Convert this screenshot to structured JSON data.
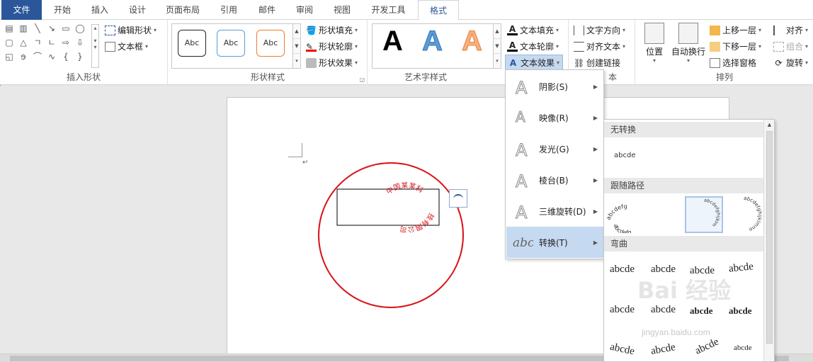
{
  "tabs": [
    {
      "label": "文件"
    },
    {
      "label": "开始"
    },
    {
      "label": "插入"
    },
    {
      "label": "设计"
    },
    {
      "label": "页面布局"
    },
    {
      "label": "引用"
    },
    {
      "label": "邮件"
    },
    {
      "label": "审阅"
    },
    {
      "label": "视图"
    },
    {
      "label": "开发工具"
    },
    {
      "label": "格式"
    }
  ],
  "ribbon": {
    "insert_shape": {
      "label": "插入形状",
      "edit_shape": "编辑形状",
      "text_box": "文本框"
    },
    "shape_styles": {
      "label": "形状样式",
      "style_sample": "Abc",
      "fill": "形状填充",
      "outline": "形状轮廓",
      "effects": "形状效果"
    },
    "wordart": {
      "label": "艺术字样式",
      "letter": "A",
      "text_fill": "文本填充",
      "text_outline": "文本轮廓",
      "text_effects": "文本效果"
    },
    "text": {
      "label_partial": "本",
      "direction": "文字方向",
      "align": "对齐文本",
      "link": "创建链接"
    },
    "arrange": {
      "label": "排列",
      "position": "位置",
      "wrap": "自动换行",
      "bring_forward": "上移一层",
      "send_backward": "下移一层",
      "selection_pane": "选择窗格",
      "align": "对齐",
      "group": "组合",
      "rotate": "旋转"
    }
  },
  "document": {
    "stamp_top": "中国某某科",
    "stamp_bottom": "技有限公司",
    "paragraph_mark": "↵"
  },
  "menu": {
    "items": [
      {
        "label": "阴影(S)"
      },
      {
        "label": "映像(R)"
      },
      {
        "label": "发光(G)"
      },
      {
        "label": "棱台(B)"
      },
      {
        "label": "三维旋转(D)"
      },
      {
        "label": "转换(T)"
      }
    ]
  },
  "submenu": {
    "no_transform": "无转换",
    "sample": "abcde",
    "follow_path": "跟随路径",
    "warp": "弯曲",
    "path_samples": [
      "abcdefg",
      "abcdefghijklm",
      "abcdefghijklmno"
    ]
  },
  "watermark": {
    "text": "jingyan.baidu.com",
    "big": "Bai 经验"
  },
  "colors": {
    "file_tab": "#2b579a",
    "accent": "#2b579a",
    "stamp_red": "#d9151b",
    "menu_selected": "#c5d9f1"
  }
}
